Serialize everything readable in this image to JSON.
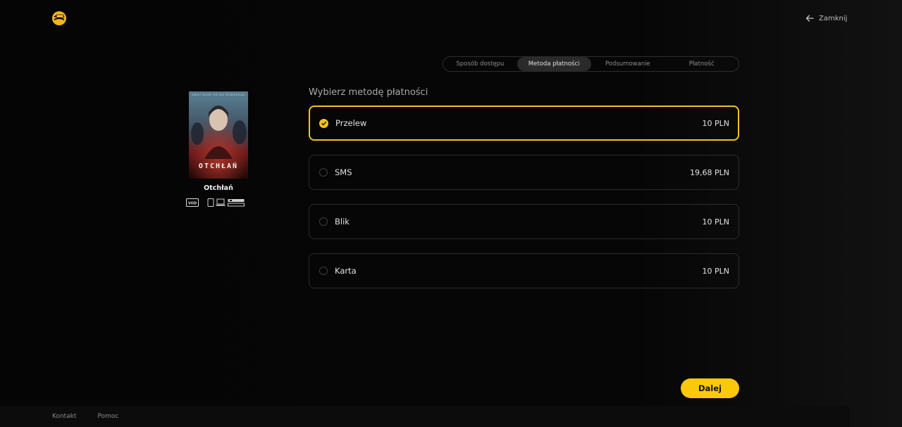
{
  "header": {
    "close_label": "Zamknij"
  },
  "steps": [
    {
      "label": "Sposób dostępu",
      "active": false
    },
    {
      "label": "Metoda płatności",
      "active": true
    },
    {
      "label": "Podsumowanie",
      "active": false
    },
    {
      "label": "Płatność",
      "active": false
    }
  ],
  "movie": {
    "title": "Otchłań",
    "poster_title": "OTCHŁAŃ",
    "poster_tagline": "ŚWIAT NIGDY SIĘ NIE DOWIEDZIAŁ",
    "badge": "VOD",
    "devices": [
      "tablet-icon",
      "laptop-icon",
      "tv-box-icon"
    ]
  },
  "payment": {
    "title": "Wybierz metodę płatności",
    "options": [
      {
        "label": "Przelew",
        "price": "10 PLN",
        "selected": true
      },
      {
        "label": "SMS",
        "price": "19,68 PLN",
        "selected": false
      },
      {
        "label": "Blik",
        "price": "10 PLN",
        "selected": false
      },
      {
        "label": "Karta",
        "price": "10 PLN",
        "selected": false
      }
    ]
  },
  "actions": {
    "next_label": "Dalej"
  },
  "footer": {
    "links": [
      "Kontakt",
      "Pomoc"
    ]
  },
  "colors": {
    "accent": "#f2c318",
    "button": "#fcc80a",
    "background": "#050505"
  }
}
